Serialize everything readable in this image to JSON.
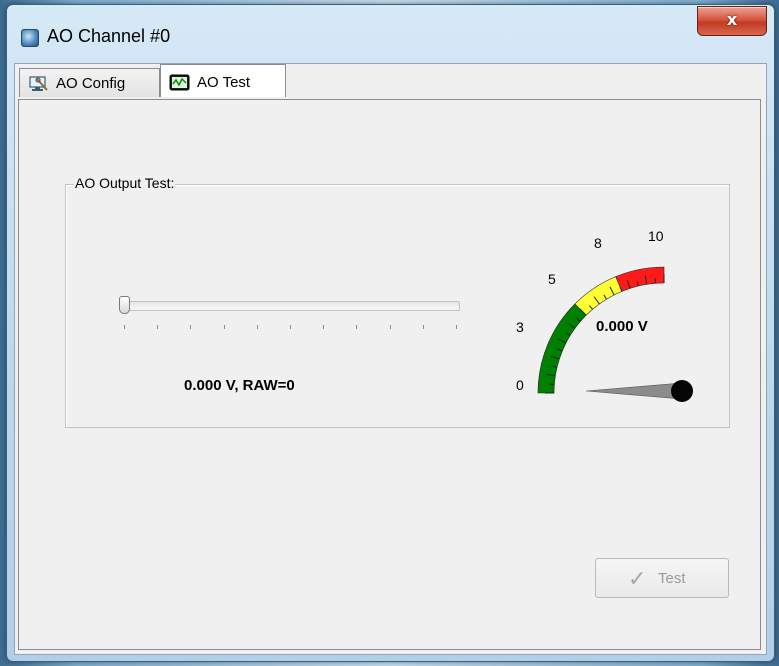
{
  "window": {
    "title": "AO Channel #0",
    "close_glyph": "x"
  },
  "tabs": [
    {
      "label": "AO Config",
      "icon": "monitor-config-icon",
      "active": false
    },
    {
      "label": "AO Test",
      "icon": "oscilloscope-icon",
      "active": true
    }
  ],
  "output_test": {
    "group_label": "AO Output Test:",
    "slider": {
      "value_fraction": 0.0,
      "tick_count": 11
    },
    "readout": "0.000 V, RAW=0"
  },
  "gauge": {
    "scale_labels": [
      "0",
      "3",
      "5",
      "8",
      "10"
    ],
    "value_label": "0.000 V",
    "value": 0,
    "min": 0,
    "max": 10,
    "zone_colors": {
      "green": "#008000",
      "yellow": "#ffff33",
      "red": "#ff1a1a"
    }
  },
  "buttons": {
    "test_label": "Test",
    "test_enabled": false
  },
  "colors": {
    "title_accent": "#c23a22"
  }
}
